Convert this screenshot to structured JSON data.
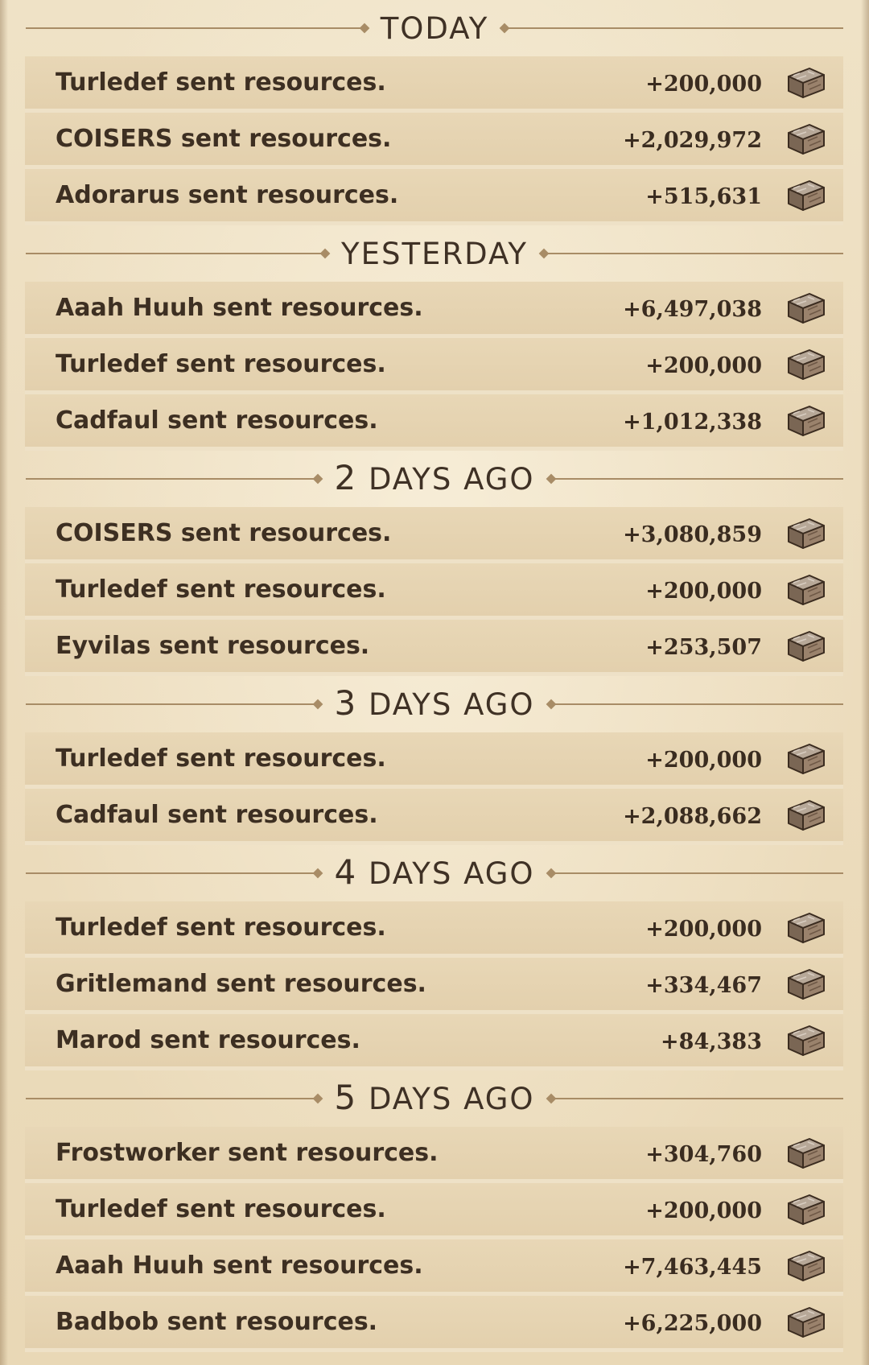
{
  "resource_icon": "stone-block-icon",
  "colors": {
    "background": "#efe2c6",
    "row_background": "#e6d4b2",
    "divider": "#a88c66",
    "text": "#3d2f22"
  },
  "sections": [
    {
      "title_num": "",
      "title_text": "TODAY",
      "rows": [
        {
          "text": "Turledef sent resources.",
          "amount": "+200,000"
        },
        {
          "text": "COISERS sent resources.",
          "amount": "+2,029,972"
        },
        {
          "text": "Adorarus sent resources.",
          "amount": "+515,631"
        }
      ]
    },
    {
      "title_num": "",
      "title_text": "YESTERDAY",
      "rows": [
        {
          "text": "Aaah Huuh sent resources.",
          "amount": "+6,497,038"
        },
        {
          "text": "Turledef sent resources.",
          "amount": "+200,000"
        },
        {
          "text": "Cadfaul sent resources.",
          "amount": "+1,012,338"
        }
      ]
    },
    {
      "title_num": "2",
      "title_text": " DAYS AGO",
      "rows": [
        {
          "text": "COISERS sent resources.",
          "amount": "+3,080,859"
        },
        {
          "text": "Turledef sent resources.",
          "amount": "+200,000"
        },
        {
          "text": "Eyvilas sent resources.",
          "amount": "+253,507"
        }
      ]
    },
    {
      "title_num": "3",
      "title_text": " DAYS AGO",
      "rows": [
        {
          "text": "Turledef sent resources.",
          "amount": "+200,000"
        },
        {
          "text": "Cadfaul sent resources.",
          "amount": "+2,088,662"
        }
      ]
    },
    {
      "title_num": "4",
      "title_text": " DAYS AGO",
      "rows": [
        {
          "text": "Turledef sent resources.",
          "amount": "+200,000"
        },
        {
          "text": "Gritlemand sent resources.",
          "amount": "+334,467"
        },
        {
          "text": "Marod sent resources.",
          "amount": "+84,383"
        }
      ]
    },
    {
      "title_num": "5",
      "title_text": " DAYS AGO",
      "rows": [
        {
          "text": "Frostworker sent resources.",
          "amount": "+304,760"
        },
        {
          "text": "Turledef sent resources.",
          "amount": "+200,000"
        },
        {
          "text": "Aaah Huuh sent resources.",
          "amount": "+7,463,445"
        },
        {
          "text": "Badbob sent resources.",
          "amount": "+6,225,000"
        }
      ]
    }
  ]
}
